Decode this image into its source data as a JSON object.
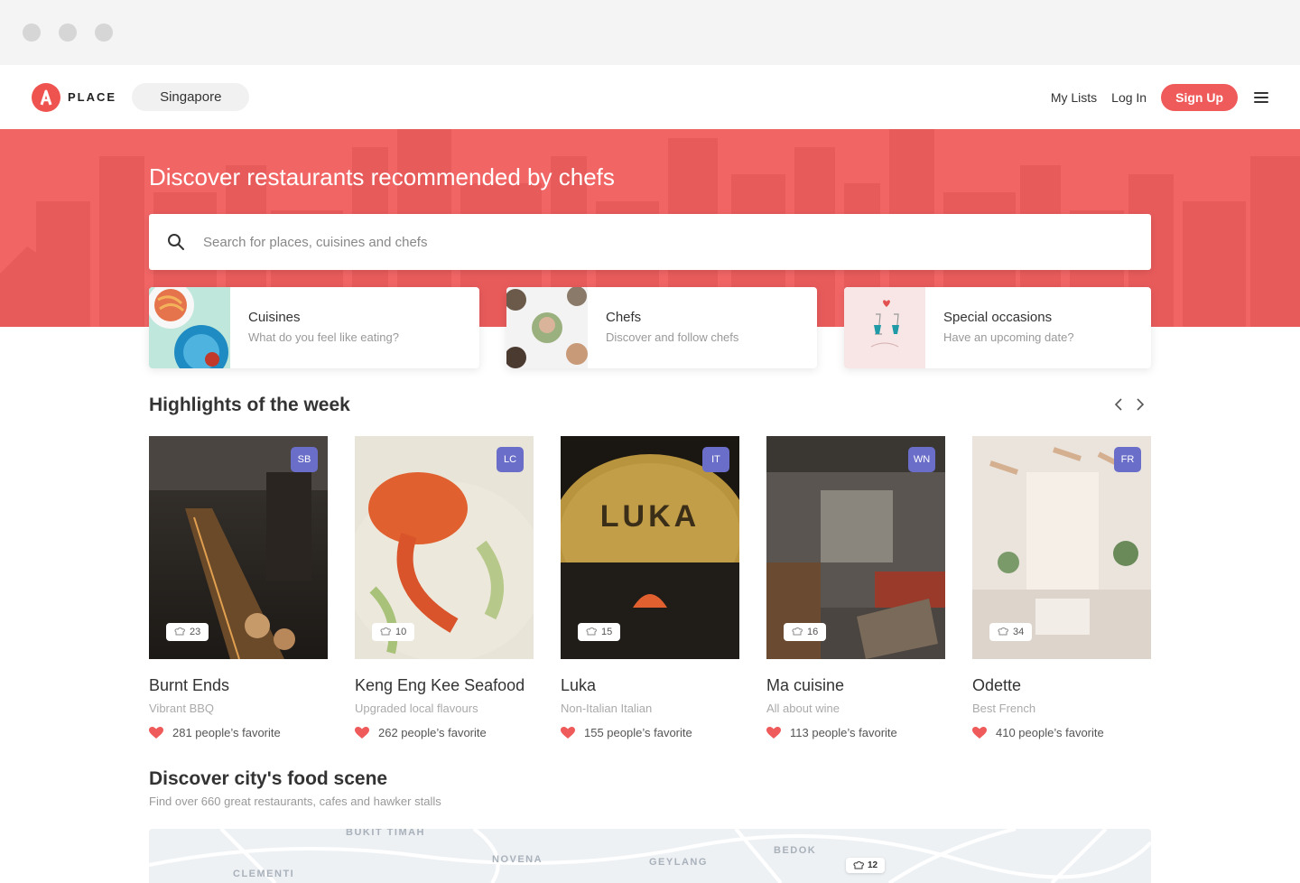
{
  "brand": {
    "name": "PLACE",
    "logo_letter": "A",
    "accent": "#ef5a5a"
  },
  "nav": {
    "city": "Singapore",
    "my_lists": "My Lists",
    "log_in": "Log In",
    "sign_up": "Sign Up"
  },
  "hero": {
    "title": "Discover restaurants recommended by chefs",
    "search_placeholder": "Search for places, cuisines and chefs"
  },
  "categories": [
    {
      "title": "Cuisines",
      "subtitle": "What do you feel like eating?"
    },
    {
      "title": "Chefs",
      "subtitle": "Discover and follow chefs"
    },
    {
      "title": "Special occasions",
      "subtitle": "Have an upcoming date?"
    }
  ],
  "highlights": {
    "title": "Highlights of the week",
    "restaurants": [
      {
        "name": "Burnt Ends",
        "desc": "Vibrant BBQ",
        "badge": "SB",
        "count": "23",
        "fav": "281 people’s favorite"
      },
      {
        "name": "Keng Eng Kee Seafood",
        "desc": "Upgraded local flavours",
        "badge": "LC",
        "count": "10",
        "fav": "262 people’s favorite"
      },
      {
        "name": "Luka",
        "desc": "Non-Italian Italian",
        "badge": "IT",
        "count": "15",
        "fav": "155 people’s favorite"
      },
      {
        "name": "Ma cuisine",
        "desc": "All about wine",
        "badge": "WN",
        "count": "16",
        "fav": "113 people’s favorite"
      },
      {
        "name": "Odette",
        "desc": "Best French",
        "badge": "FR",
        "count": "34",
        "fav": "410 people’s favorite"
      }
    ]
  },
  "food_scene": {
    "title": "Discover city's food scene",
    "subtitle": "Find over 660 great restaurants, cafes and hawker stalls",
    "map_labels": [
      "BUKIT TIMAH",
      "NOVENA",
      "GEYLANG",
      "BEDOK",
      "CLEMENTI"
    ],
    "pin_count": "12"
  }
}
